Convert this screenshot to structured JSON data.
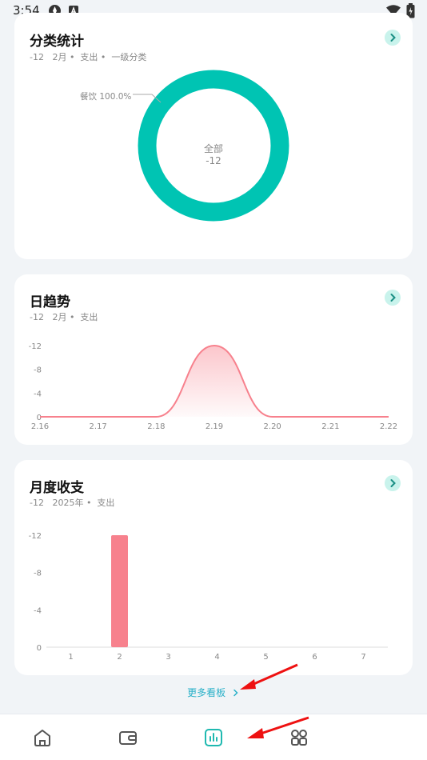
{
  "status": {
    "time": "3:54"
  },
  "category_card": {
    "title": "分类统计",
    "subtitle": "-12   2月 •  支出 •  一级分类",
    "slice_label": "餐饮 100.0%",
    "center_label": "全部",
    "center_value": "-12"
  },
  "daily_card": {
    "title": "日趋势",
    "subtitle": "-12   2月 •  支出"
  },
  "monthly_card": {
    "title": "月度收支",
    "subtitle": "-12   2025年 •  支出"
  },
  "more_link": "更多看板",
  "colors": {
    "teal": "#00c4b3",
    "pink": "#f7818d",
    "link": "#29b0c8"
  },
  "chart_data": [
    {
      "type": "pie",
      "categories": [
        "餐饮"
      ],
      "values": [
        100.0
      ]
    },
    {
      "type": "area",
      "x": [
        "2.16",
        "2.17",
        "2.18",
        "2.19",
        "2.20",
        "2.21",
        "2.22"
      ],
      "y_ticks": [
        "-12",
        "-8",
        "-4",
        "0"
      ],
      "series": [
        {
          "values": [
            0,
            0,
            0,
            -12,
            0,
            0,
            0
          ]
        }
      ],
      "ylim": [
        0,
        -12
      ]
    },
    {
      "type": "bar",
      "categories": [
        "1",
        "2",
        "3",
        "4",
        "5",
        "6",
        "7"
      ],
      "y_ticks": [
        "-12",
        "-8",
        "-4",
        "0"
      ],
      "values": [
        0,
        -12,
        0,
        0,
        0,
        0,
        0
      ],
      "ylim": [
        0,
        -12
      ]
    }
  ]
}
